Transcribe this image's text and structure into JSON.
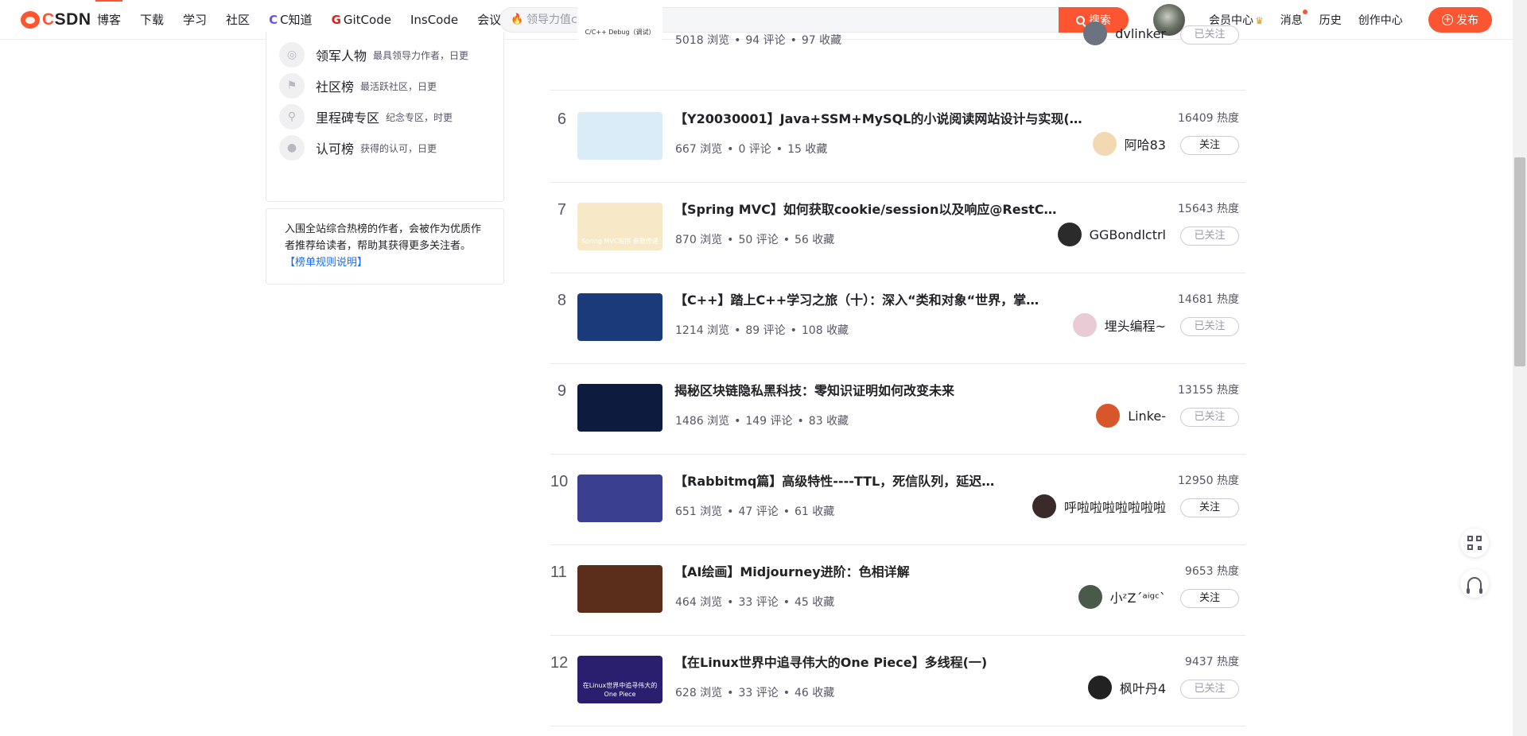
{
  "brand": {
    "logo_text_prefix": "C",
    "logo_text_suffix": "SDN",
    "accent": "#fc5531"
  },
  "nav": {
    "items": [
      {
        "label": "博客",
        "active": true
      },
      {
        "label": "下载"
      },
      {
        "label": "学习"
      },
      {
        "label": "社区"
      },
      {
        "label": "C知道",
        "icon": "C"
      },
      {
        "label": "GitCode",
        "icon": "G"
      },
      {
        "label": "InsCode"
      },
      {
        "label": "会议"
      }
    ]
  },
  "search": {
    "placeholder": "领导力值csdn",
    "button_label": "搜索"
  },
  "header_right": {
    "vip_label": "会员中心",
    "messages_label": "消息",
    "history_label": "历史",
    "creator_label": "创作中心",
    "publish_label": "发布"
  },
  "sidebar": {
    "items": [
      {
        "title": "领军人物",
        "desc": "最具领导力作者，日更",
        "icon": "medal-icon"
      },
      {
        "title": "社区榜",
        "desc": "最活跃社区，日更",
        "icon": "flag-icon"
      },
      {
        "title": "里程碑专区",
        "desc": "纪念专区，时更",
        "icon": "milestone-icon"
      },
      {
        "title": "认可榜",
        "desc": "获得的认可，日更",
        "icon": "user-icon"
      }
    ],
    "note_text": "入围全站综合热榜的作者，会被作为优质作者推荐给读者，帮助其获得更多关注者。",
    "note_link": "【榜单规则说明】"
  },
  "ranking": {
    "rows": [
      {
        "rank": "",
        "title": "",
        "views": "5018 浏览",
        "comments": "94 评论",
        "favorites": "97 收藏",
        "heat": "",
        "author": "dvlinker",
        "follow": "已关注",
        "followed": true,
        "thumb_color": "#ffffff",
        "thumb_text": "C/C++ Debug（调试）",
        "avatar_color": "#6b7280"
      },
      {
        "rank": "6",
        "title": "【Y20030001】Java+SSM+MySQL的小说阅读网站设计与实现(…",
        "views": "667 浏览",
        "comments": "0 评论",
        "favorites": "15 收藏",
        "heat": "16409 热度",
        "author": "阿哈83",
        "follow": "关注",
        "followed": false,
        "thumb_color": "#d9ecf8",
        "thumb_text": "",
        "avatar_color": "#f3d9b1"
      },
      {
        "rank": "7",
        "title": "【Spring MVC】如何获取cookie/session以及响应@RestC…",
        "views": "870 浏览",
        "comments": "50 评论",
        "favorites": "56 收藏",
        "heat": "15643 热度",
        "author": "GGBondlctrl",
        "follow": "已关注",
        "followed": true,
        "thumb_color": "#f7e9c8",
        "thumb_text": "Spring MVC程序 参数传递",
        "avatar_color": "#2b2b2b"
      },
      {
        "rank": "8",
        "title": "【C++】踏上C++学习之旅（十）：深入“类和对象“世界，掌…",
        "views": "1214 浏览",
        "comments": "89 评论",
        "favorites": "108 收藏",
        "heat": "14681 热度",
        "author": "埋头编程~",
        "follow": "已关注",
        "followed": true,
        "thumb_color": "#1b3a7a",
        "thumb_text": "",
        "avatar_color": "#e9cbd6"
      },
      {
        "rank": "9",
        "title": "揭秘区块链隐私黑科技：零知识证明如何改变未来",
        "views": "1486 浏览",
        "comments": "149 评论",
        "favorites": "83 收藏",
        "heat": "13155 热度",
        "author": "Linke-",
        "follow": "已关注",
        "followed": true,
        "thumb_color": "#0d1b3e",
        "thumb_text": "",
        "avatar_color": "#d8572a"
      },
      {
        "rank": "10",
        "title": "【Rabbitmq篇】高级特性----TTL，死信队列，延迟…",
        "views": "651 浏览",
        "comments": "47 评论",
        "favorites": "61 收藏",
        "heat": "12950 热度",
        "author": "呼啦啦啦啦啦啦啦",
        "follow": "关注",
        "followed": false,
        "thumb_color": "#3b3f8f",
        "thumb_text": "",
        "avatar_color": "#3a2a2a"
      },
      {
        "rank": "11",
        "title": "【AI绘画】Midjourney进阶：色相详解",
        "views": "464 浏览",
        "comments": "33 评论",
        "favorites": "45 收藏",
        "heat": "9653 热度",
        "author": "小ᶻZˊᵃⁱᵍᶜˋ",
        "follow": "关注",
        "followed": false,
        "thumb_color": "#5a2e1a",
        "thumb_text": "",
        "avatar_color": "#4a5a4a"
      },
      {
        "rank": "12",
        "title": "【在Linux世界中追寻伟大的One Piece】多线程(一)",
        "views": "628 浏览",
        "comments": "33 评论",
        "favorites": "46 收藏",
        "heat": "9437 热度",
        "author": "枫叶丹4",
        "follow": "已关注",
        "followed": true,
        "thumb_color": "#2a1f6e",
        "thumb_text": "在Linux世界中追寻伟大的One Piece",
        "avatar_color": "#222222"
      }
    ]
  },
  "colors": {
    "accent": "#fc5531",
    "link": "#1a6dfd",
    "text": "#222226",
    "muted": "#555666",
    "border": "#e8e8ed"
  }
}
